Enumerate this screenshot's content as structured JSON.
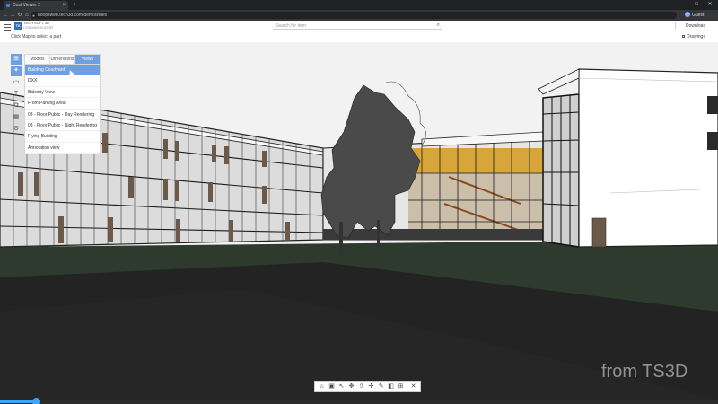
{
  "browser": {
    "tab_title": "Cost Viewer 2",
    "tab_close": "×",
    "new_tab": "+",
    "url": "hoopsweb.tech3d.com/demo/index",
    "nav": {
      "back": "←",
      "forward": "→",
      "reload": "↻",
      "home": "⌂"
    },
    "window_controls": {
      "minimize": "–",
      "maximize": "□",
      "close": "✕"
    },
    "account_label": "Guest"
  },
  "app": {
    "brand_line1": "TECH SOFT 3D",
    "brand_line2": "COMMUNICATOR",
    "logo_text": "TS",
    "search_placeholder": "Search for item",
    "download_label": "Download",
    "hint": "Click Map to select a part",
    "drawings_label": "Drawings"
  },
  "panel": {
    "tabs": [
      {
        "label": "Models",
        "active": false
      },
      {
        "label": "Dimensions",
        "active": false
      },
      {
        "label": "Views",
        "active": true
      }
    ],
    "items": [
      {
        "label": "Building Courtyard",
        "selected": true
      },
      {
        "label": "DXX",
        "selected": false
      },
      {
        "label": "Balcony View",
        "selected": false
      },
      {
        "label": "From Parking Area",
        "selected": false
      },
      {
        "label": "03 - Floor Public - Day Rendering",
        "selected": false
      },
      {
        "label": "03 - Floor Public - Night Rendering",
        "selected": false
      },
      {
        "label": "Flying Building",
        "selected": false
      },
      {
        "label": "Annotation view",
        "selected": false
      }
    ],
    "side_icons": [
      "model-tree-icon",
      "views-icon",
      "markup-icon",
      "text-icon",
      "layers-icon",
      "table-icon",
      "settings-icon"
    ]
  },
  "toolbar": {
    "buttons": [
      "home-icon",
      "camera-icon",
      "select-icon",
      "orbit-icon",
      "walk-icon",
      "move-icon",
      "markup-icon",
      "section-icon",
      "explode-icon",
      "close-icon"
    ],
    "glyphs": [
      "⌂",
      "▣",
      "↖",
      "✥",
      "⇧",
      "✢",
      "✎",
      "◧",
      "⊞",
      "✕"
    ]
  },
  "watermark": "from TS3D",
  "video_progress": 0.05,
  "colors": {
    "accent": "#6e9fe0",
    "sky": "#f2f2f2",
    "grass": "#2e3a2e",
    "road": "#2a2a2a"
  }
}
